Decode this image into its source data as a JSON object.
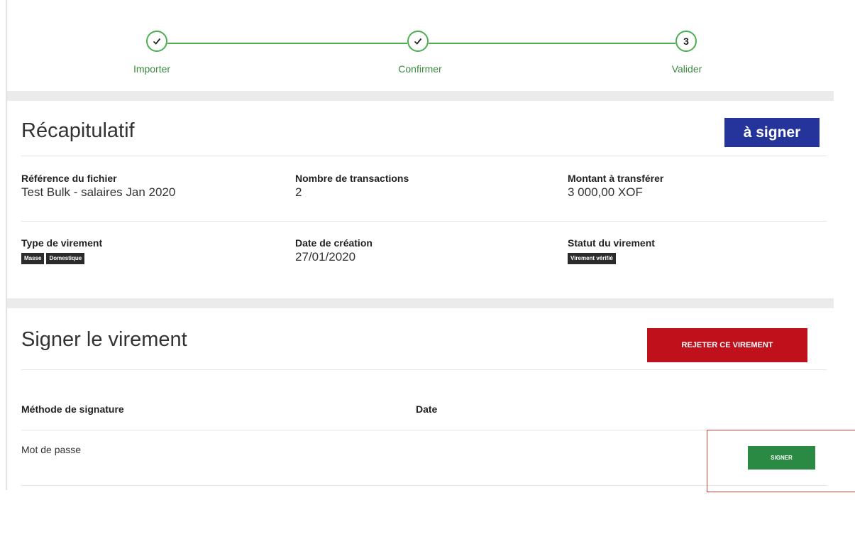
{
  "stepper": {
    "steps": [
      {
        "label": "Importer",
        "state": "done",
        "marker": "✓"
      },
      {
        "label": "Confirmer",
        "state": "done",
        "marker": "✓"
      },
      {
        "label": "Valider",
        "state": "current",
        "marker": "3"
      }
    ],
    "accent": "#4caf50"
  },
  "summary": {
    "title": "Récapitulatif",
    "status_badge": "à signer",
    "fields": {
      "file_ref": {
        "label": "Référence du fichier",
        "value": "Test Bulk - salaires Jan 2020"
      },
      "tx_count": {
        "label": "Nombre de transactions",
        "value": "2"
      },
      "amount": {
        "label": "Montant à transférer",
        "value": "3 000,00 XOF"
      },
      "transfer_type": {
        "label": "Type de virement",
        "tags": [
          "Masse",
          "Domestique"
        ]
      },
      "created": {
        "label": "Date de création",
        "value": "27/01/2020"
      },
      "status": {
        "label": "Statut du virement",
        "tags": [
          "Virement vérifié"
        ]
      }
    }
  },
  "signing": {
    "title": "Signer le virement",
    "reject_label": "REJETER CE VIREMENT",
    "columns": [
      "Méthode de signature",
      "Date"
    ],
    "rows": [
      {
        "method": "Mot de passe",
        "date": "",
        "action_label": "SIGNER"
      }
    ]
  },
  "colors": {
    "status_badge": "#24349a",
    "reject": "#c0101b",
    "sign": "#2a8a44",
    "highlight": "#d63a3a"
  }
}
